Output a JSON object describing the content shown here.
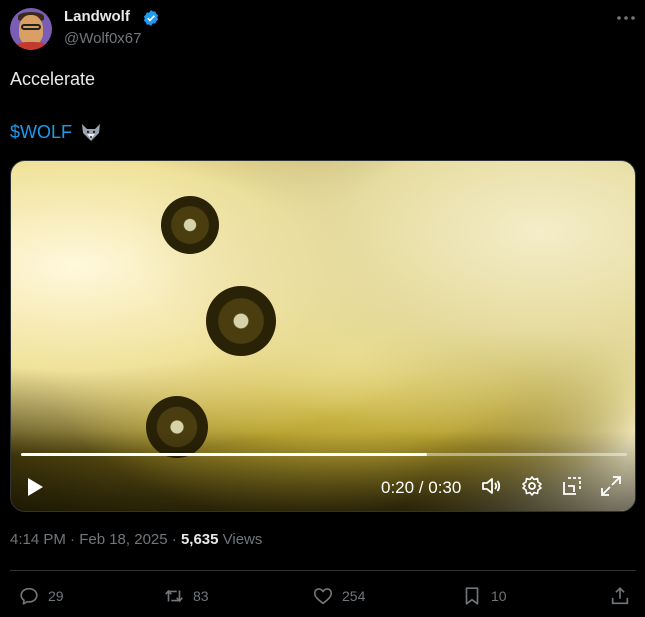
{
  "tweet": {
    "author_name": "Landwolf",
    "author_handle": "@Wolf0x67",
    "verified": true,
    "text_line1": "Accelerate",
    "text_line2": "$WOLF",
    "emoji": "wolf-face-emoji",
    "timestamp": "4:14 PM · Feb 18, 2025 · ",
    "views_count": "5,635",
    "views_label": " Views"
  },
  "video": {
    "current_time": "0:20 / 0:30",
    "progress": 0.67
  },
  "actions": {
    "replies": "29",
    "reposts": "83",
    "likes": "254",
    "bookmarks": "10"
  },
  "colors": {
    "accent": "#1d9bf0",
    "muted": "#71767b",
    "text": "#e7e9ea",
    "background": "#000000"
  }
}
